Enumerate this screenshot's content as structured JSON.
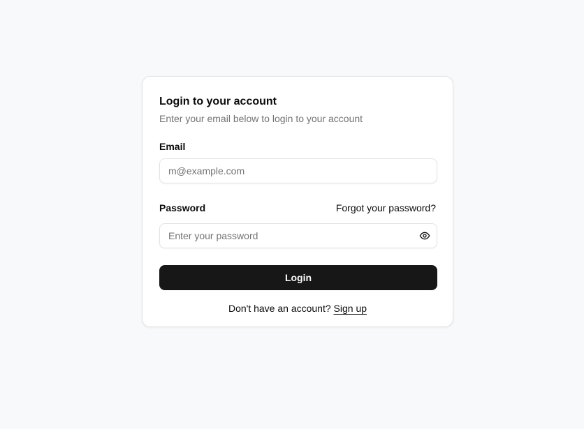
{
  "card": {
    "title": "Login to your account",
    "subtitle": "Enter your email below to login to your account"
  },
  "email": {
    "label": "Email",
    "placeholder": "m@example.com",
    "value": ""
  },
  "password": {
    "label": "Password",
    "forgot_label": "Forgot your password?",
    "placeholder": "Enter your password",
    "value": "",
    "toggle_icon": "eye-icon"
  },
  "login_button": {
    "label": "Login"
  },
  "signup": {
    "prompt": "Don't have an account?",
    "link_label": "Sign up"
  }
}
